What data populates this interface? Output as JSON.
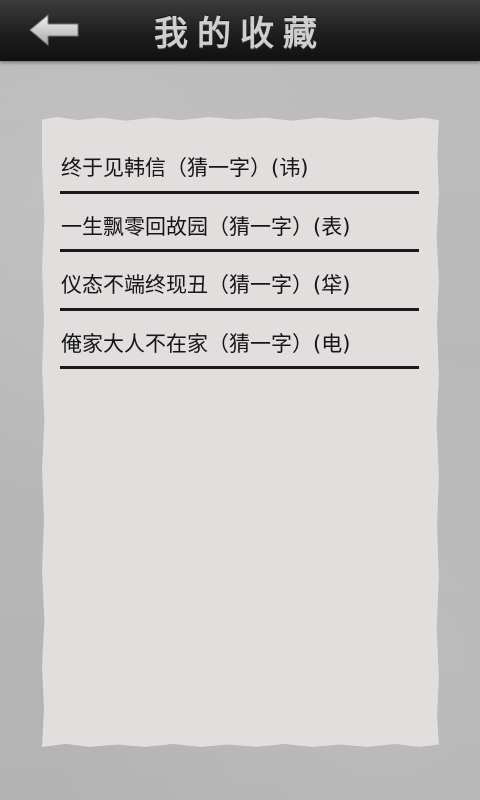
{
  "header": {
    "title": "我的收藏",
    "back_icon": "back-arrow-icon"
  },
  "favorites": [
    {
      "text": "终于见韩信（猜一字）(讳)"
    },
    {
      "text": "一生飘零回故园（猜一字）(表)"
    },
    {
      "text": "仪态不端终现丑（猜一字）(牮)"
    },
    {
      "text": "俺家大人不在家（猜一字）(电)"
    }
  ],
  "colors": {
    "header_bg": "#1e1e1e",
    "title_text": "#cfcfcf",
    "paper_bg": "#e2dede",
    "page_bg": "#b9b9b9",
    "divider": "#1a1a1a"
  }
}
